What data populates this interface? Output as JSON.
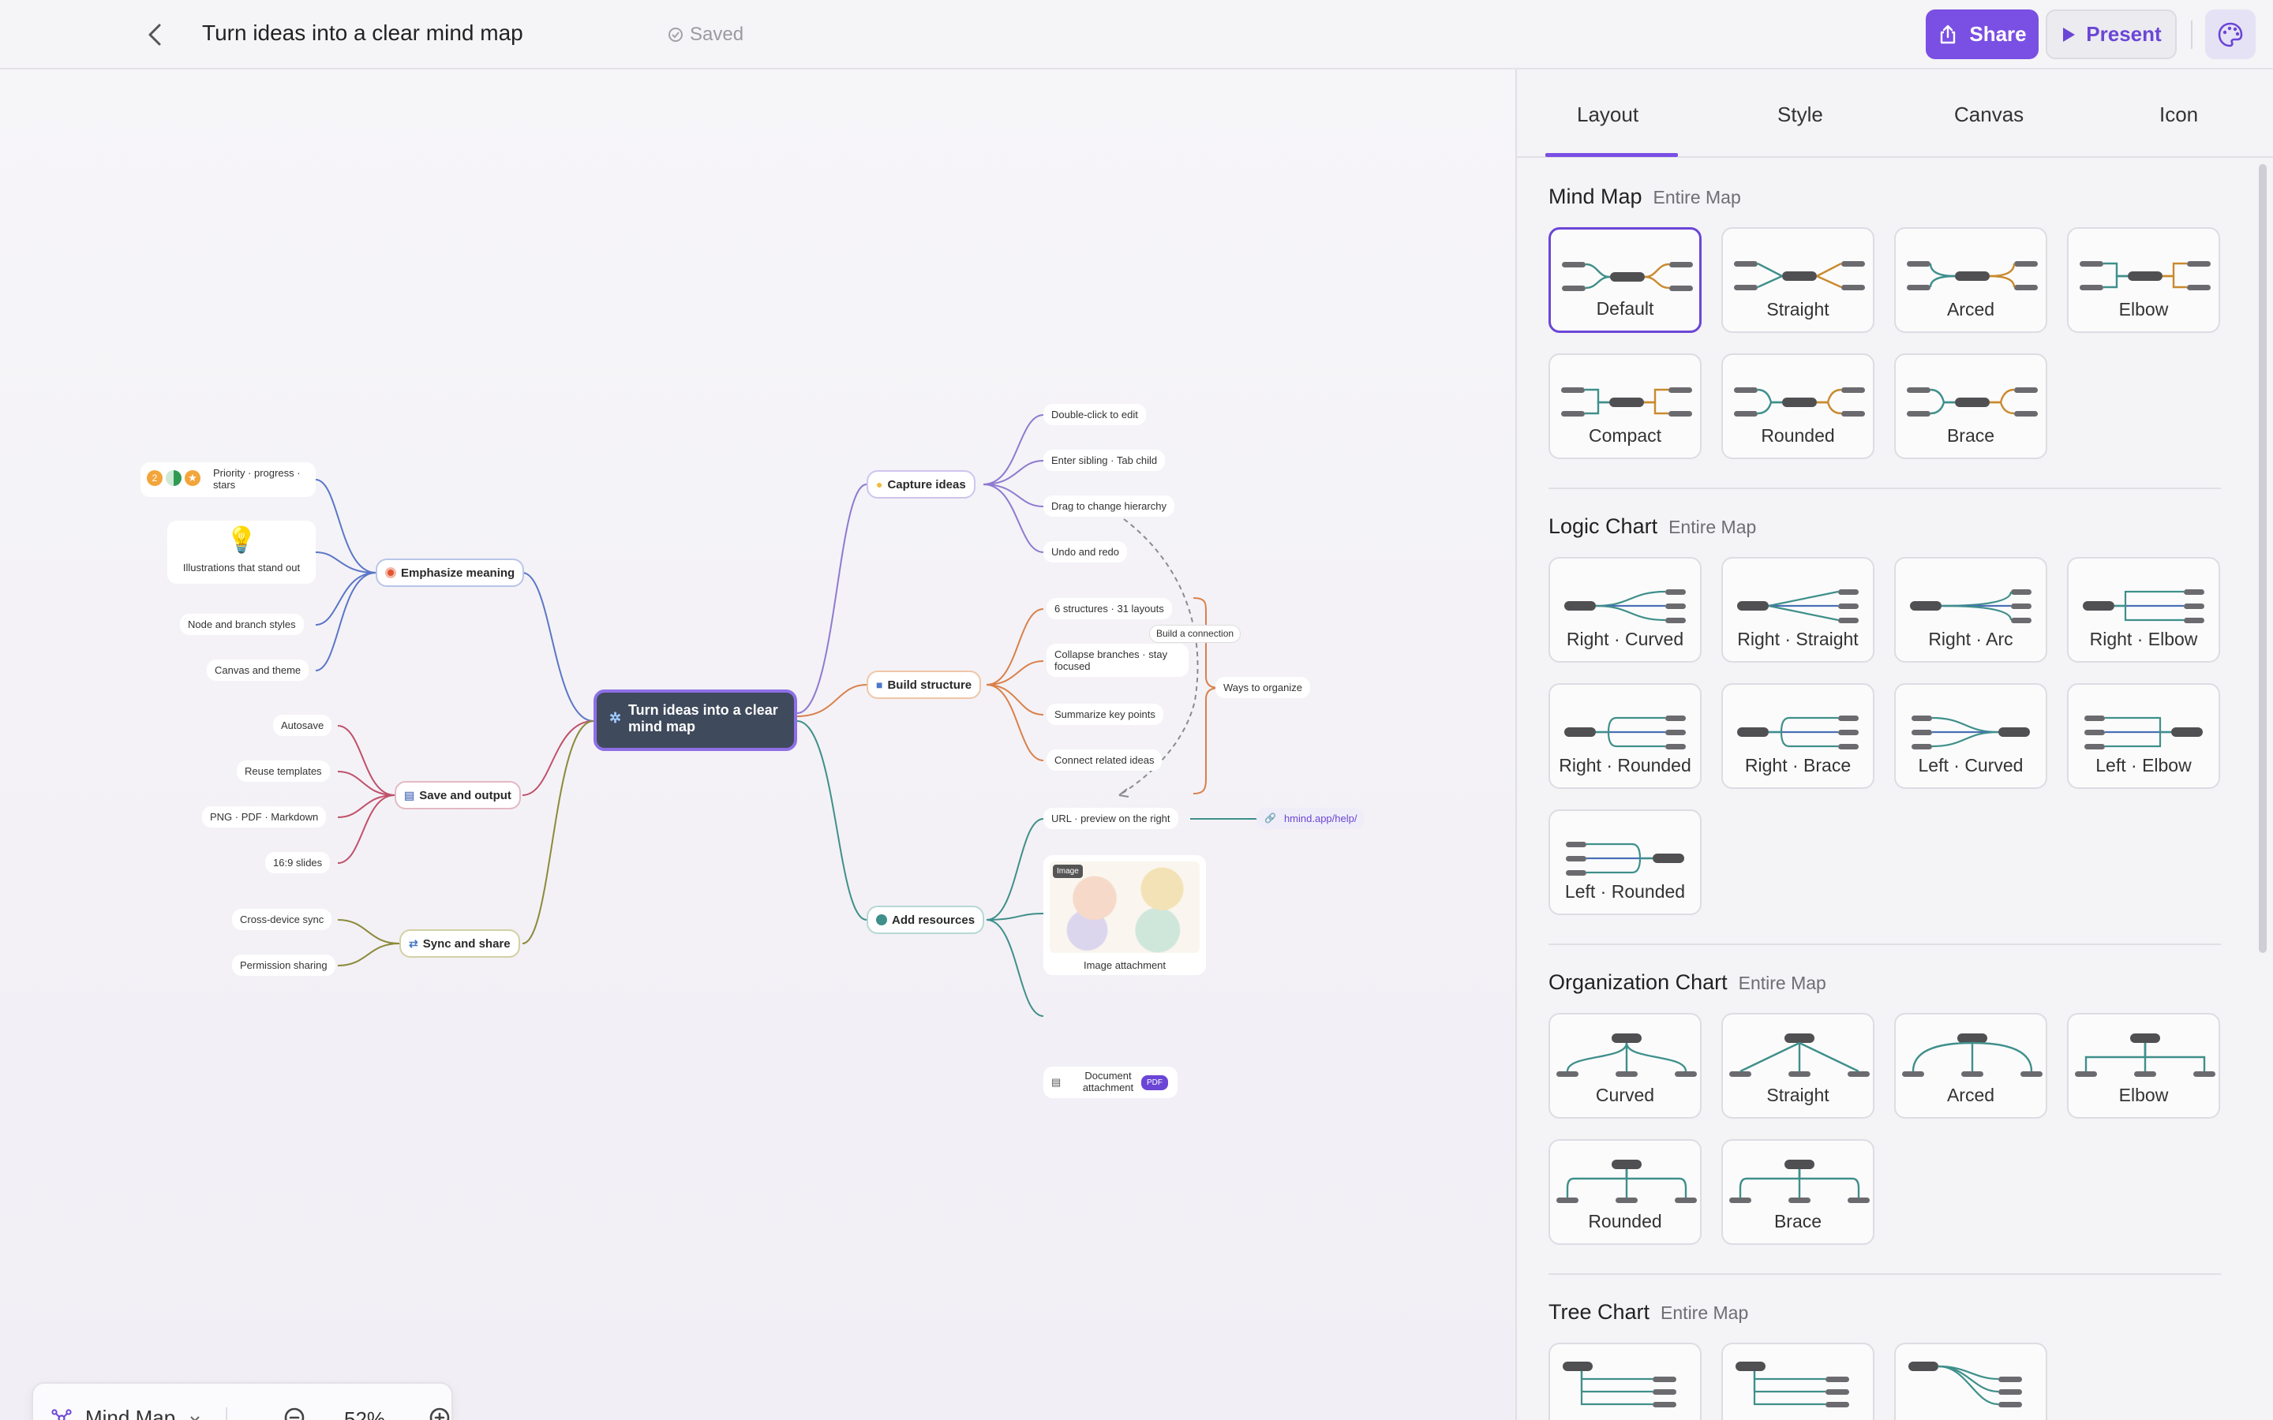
{
  "header": {
    "title": "Turn ideas into a clear mind map",
    "saved": "Saved",
    "share": "Share",
    "present": "Present"
  },
  "map": {
    "central": "Turn ideas into a clear mind map",
    "left": {
      "emphasize": {
        "label": "Emphasize meaning",
        "children": [
          "Priority · progress · stars",
          "Illustrations that stand out",
          "Node and branch styles",
          "Canvas and theme"
        ],
        "badges": [
          "2"
        ]
      },
      "save": {
        "label": "Save and output",
        "children": [
          "Autosave",
          "Reuse templates",
          "PNG · PDF · Markdown",
          "16:9 slides"
        ]
      },
      "sync": {
        "label": "Sync and share",
        "children": [
          "Cross-device sync",
          "Permission sharing"
        ]
      }
    },
    "right": {
      "capture": {
        "label": "Capture ideas",
        "children": [
          "Double-click to edit",
          "Enter sibling · Tab child",
          "Drag to change hierarchy",
          "Undo and redo"
        ]
      },
      "build": {
        "label": "Build structure",
        "children": [
          "6 structures · 31 layouts",
          "Collapse branches · stay focused",
          "Summarize key points",
          "Connect related ideas"
        ],
        "summary": "Ways to organize",
        "connection": "Build a connection"
      },
      "resources": {
        "label": "Add resources",
        "children": [
          "URL · preview on the right",
          "Image attachment",
          "Document attachment"
        ],
        "link": "hmind.app/help/",
        "image_tag": "Image",
        "pdf_badge": "PDF"
      }
    }
  },
  "zoom": {
    "mode": "Mind Map",
    "level": "52%"
  },
  "panel": {
    "tabs": [
      "Layout",
      "Style",
      "Canvas",
      "Icon"
    ],
    "active_tab": "Layout",
    "sections": [
      {
        "title": "Mind Map",
        "sub": "Entire Map",
        "items": [
          "Default",
          "Straight",
          "Arced",
          "Elbow",
          "Compact",
          "Rounded",
          "Brace"
        ],
        "selected": "Default"
      },
      {
        "title": "Logic Chart",
        "sub": "Entire Map",
        "items": [
          "Right · Curved",
          "Right · Straight",
          "Right · Arc",
          "Right · Elbow",
          "Right · Rounded",
          "Right · Brace",
          "Left · Curved",
          "Left · Elbow",
          "Left · Rounded"
        ]
      },
      {
        "title": "Organization Chart",
        "sub": "Entire Map",
        "items": [
          "Curved",
          "Straight",
          "Arced",
          "Elbow",
          "Rounded",
          "Brace"
        ]
      },
      {
        "title": "Tree Chart",
        "sub": "Entire Map",
        "items": [
          "",
          "",
          ""
        ]
      }
    ]
  },
  "colors": {
    "accent": "#7a4fe3",
    "central_fill": "#3f4a5c",
    "branch_blue": "#5a76c6",
    "branch_red": "#c0506a",
    "branch_olive": "#8b8a3a",
    "branch_purple": "#8e7ad0",
    "branch_orange": "#d9804a",
    "branch_teal": "#3f8f8a"
  }
}
